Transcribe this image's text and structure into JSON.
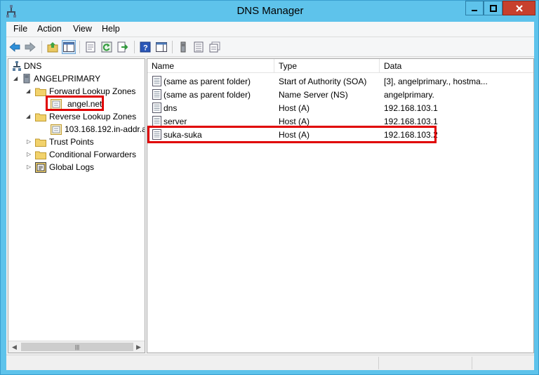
{
  "window": {
    "title": "DNS Manager"
  },
  "menu": [
    "File",
    "Action",
    "View",
    "Help"
  ],
  "toolbar": {
    "icons": [
      "back-arrow-icon",
      "forward-arrow-icon",
      "up-folder-icon",
      "show-hide-tree-icon",
      "properties-icon",
      "refresh-icon",
      "export-list-icon",
      "help-icon",
      "show-hide-action-pane-icon",
      "new-host-icon",
      "new-alias-icon",
      "new-mail-exchanger-icon"
    ]
  },
  "tree": {
    "root": "DNS",
    "server": "ANGELPRIMARY",
    "forward_zones": "Forward Lookup Zones",
    "forward_zone_child": "angel.net",
    "reverse_zones": "Reverse Lookup Zones",
    "reverse_zone_child": "103.168.192.in-addr.a",
    "trust_points": "Trust Points",
    "conditional_forwarders": "Conditional Forwarders",
    "global_logs": "Global Logs"
  },
  "columns": {
    "name": "Name",
    "type": "Type",
    "data": "Data"
  },
  "records": [
    {
      "name": "(same as parent folder)",
      "type": "Start of Authority (SOA)",
      "data": "[3], angelprimary., hostma..."
    },
    {
      "name": "(same as parent folder)",
      "type": "Name Server (NS)",
      "data": "angelprimary."
    },
    {
      "name": "dns",
      "type": "Host (A)",
      "data": "192.168.103.1"
    },
    {
      "name": "server",
      "type": "Host (A)",
      "data": "192.168.103.1"
    },
    {
      "name": "suka-suka",
      "type": "Host (A)",
      "data": "192.168.103.2"
    }
  ],
  "colors": {
    "title_bar": "#5ec3eb",
    "close_button": "#c7402d",
    "highlight": "#e00000"
  }
}
